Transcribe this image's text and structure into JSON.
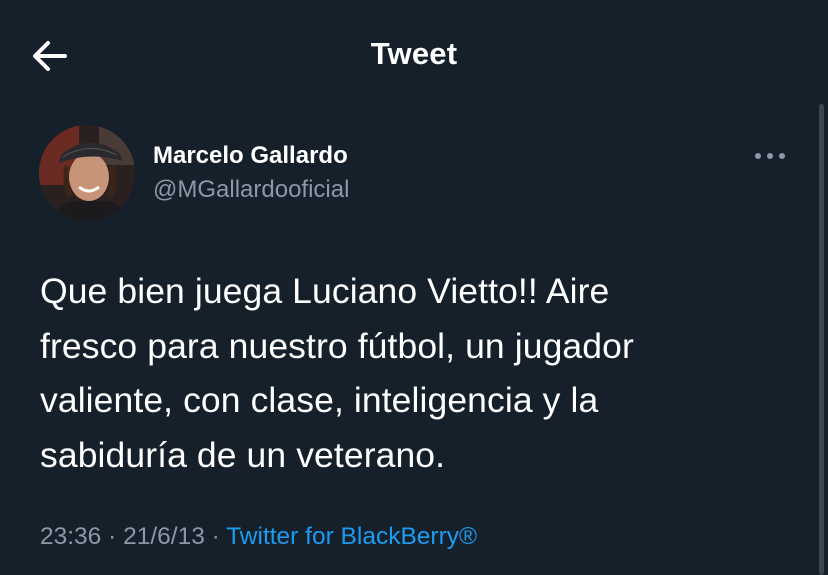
{
  "header": {
    "title": "Tweet",
    "back_icon": "arrow-left-icon"
  },
  "tweet": {
    "author": {
      "name": "Marcelo Gallardo",
      "handle": "@MGallardooficial"
    },
    "more_icon": "more-dots-icon",
    "text_lines": [
      "Que bien juega Luciano Vietto!! Aire",
      "fresco para nuestro fútbol, un jugador",
      "valiente, con clase, inteligencia y la",
      "sabiduría de un veterano."
    ],
    "meta": {
      "time": "23:36",
      "date": "21/6/13",
      "separator": " · ",
      "source": "Twitter for BlackBerry®"
    }
  },
  "colors": {
    "background": "#15202b",
    "text_primary": "#ffffff",
    "text_secondary": "#8b98a5",
    "link": "#1d9bf0"
  }
}
